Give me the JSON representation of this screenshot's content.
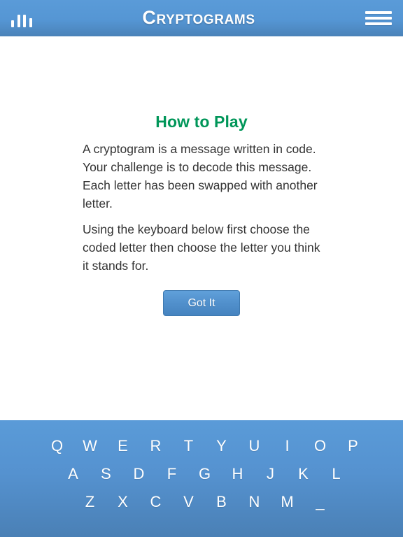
{
  "header": {
    "title": "Cryptograms",
    "stats_icon": "bar-chart-icon",
    "menu_icon": "hamburger-menu-icon",
    "background_color": "#5a9bd8"
  },
  "main": {
    "heading": "How to Play",
    "heading_color": "#009659",
    "paragraphs": [
      "A cryptogram is a message written in code. Your challenge is to decode this message. Each letter has been swapped with another letter.",
      "Using the keyboard below first choose the coded letter then choose the letter you think it stands for."
    ],
    "button": {
      "label": "Got It",
      "color": "#5190cc"
    }
  },
  "keyboard": {
    "background_color": "#5592d0",
    "key_color": "#ffffff",
    "rows": [
      [
        "Q",
        "W",
        "E",
        "R",
        "T",
        "Y",
        "U",
        "I",
        "O",
        "P"
      ],
      [
        "A",
        "S",
        "D",
        "F",
        "G",
        "H",
        "J",
        "K",
        "L"
      ],
      [
        "Z",
        "X",
        "C",
        "V",
        "B",
        "N",
        "M",
        "_"
      ]
    ]
  }
}
